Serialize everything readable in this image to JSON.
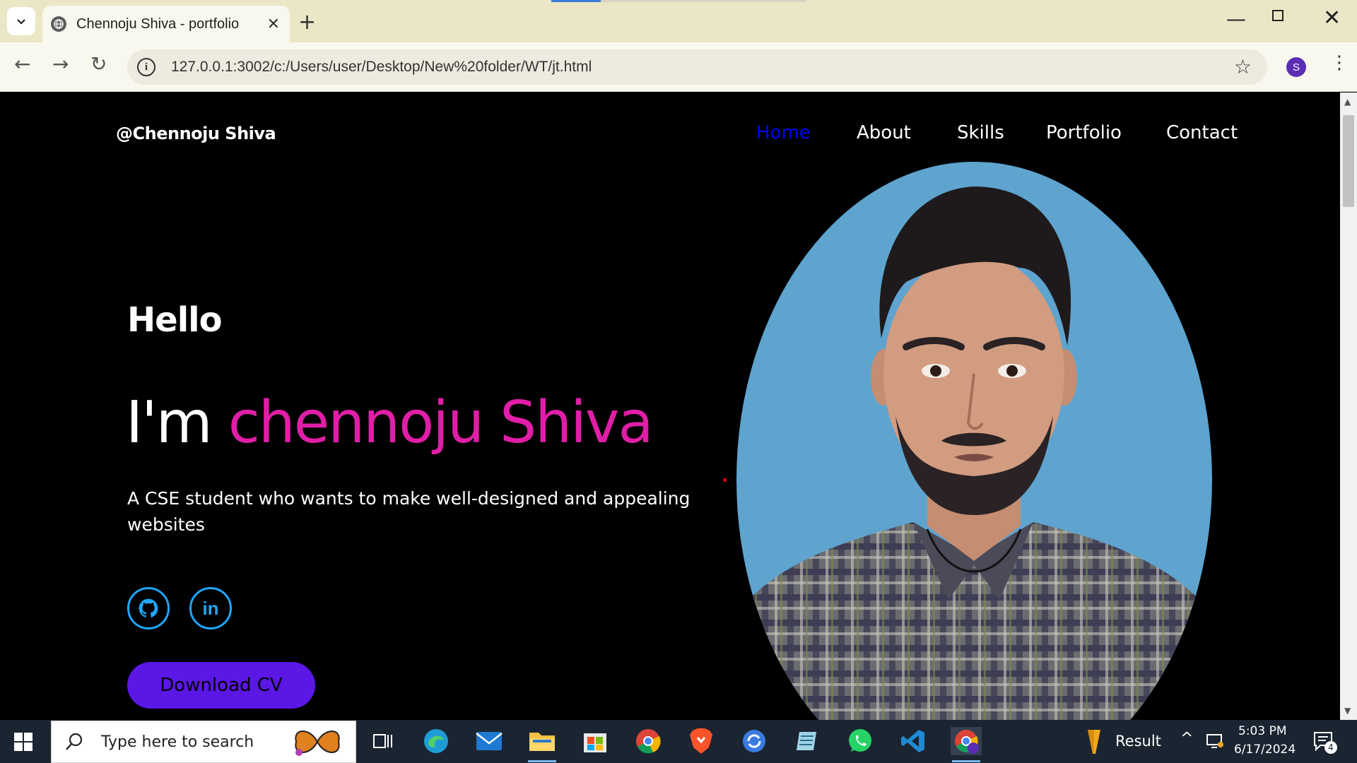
{
  "browser": {
    "tab_title": "Chennoju Shiva - portfolio",
    "url": "127.0.0.1:3002/c:/Users/user/Desktop/New%20folder/WT/jt.html",
    "profile_initial": "S"
  },
  "site": {
    "logo": "@Chennoju Shiva",
    "nav": {
      "home": "Home",
      "about": "About",
      "skills": "Skills",
      "portfolio": "Portfolio",
      "contact": "Contact"
    },
    "hero": {
      "greeting": "Hello",
      "intro": "I'm",
      "name": "chennoju Shiva",
      "tagline": "A CSE student who wants to make well-designed and appealing websites",
      "download_cv": "Download CV"
    },
    "social_icons": [
      "github-icon",
      "linkedin-icon"
    ],
    "colors": {
      "nav_active": "#0000ff",
      "name_accent": "#e01ea7",
      "social_ring": "#1ea7fd",
      "cv_button": "#5b17e6",
      "photo_bg": "#5ea4cf"
    }
  },
  "taskbar": {
    "search_placeholder": "Type here to search",
    "tray_label": "Result",
    "time": "5:03 PM",
    "date": "6/17/2024",
    "notification_count": "4",
    "apps": [
      "task-view",
      "edge",
      "mail",
      "file-explorer",
      "store",
      "chrome",
      "brave",
      "sync-app",
      "notepad-app",
      "whatsapp",
      "vscode",
      "chrome-profile"
    ]
  }
}
